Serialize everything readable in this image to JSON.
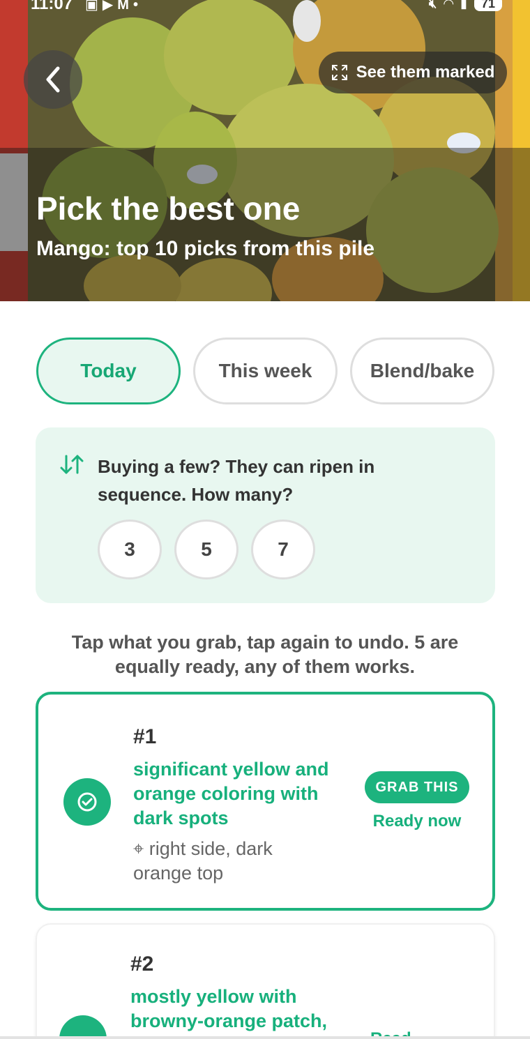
{
  "status_bar": {
    "time": "11:07",
    "battery": "71",
    "left_icons": [
      "screenshot-icon",
      "youtube-icon",
      "gmail-icon",
      "dot-icon"
    ],
    "right_icons": [
      "mute-icon",
      "wifi-icon",
      "signal-icon"
    ]
  },
  "hero": {
    "title": "Pick the best one",
    "subtitle": "Mango: top 10 picks from this pile",
    "see_marked_label": "See them marked"
  },
  "tabs": [
    {
      "label": "Today",
      "active": true
    },
    {
      "label": "This week",
      "active": false
    },
    {
      "label": "Blend/bake",
      "active": false
    }
  ],
  "sequence": {
    "text": "Buying a few? They can ripen in sequence. How many?",
    "options": [
      "3",
      "5",
      "7"
    ]
  },
  "instruction": "Tap what you grab, tap again to undo. 5 are equally ready, any of them works.",
  "picks": [
    {
      "rank": "#1",
      "description": "significant yellow and orange coloring with dark spots",
      "location": "right side, dark orange top",
      "action": "GRAB THIS",
      "readiness": "Ready now",
      "selected": true
    },
    {
      "rank": "#2",
      "description": "mostly yellow with browny-orange patch,",
      "readiness": "Read",
      "selected": false
    }
  ],
  "colors": {
    "accent": "#1db37e",
    "accent_light": "#e8f7f0",
    "text_dark": "#333333"
  }
}
